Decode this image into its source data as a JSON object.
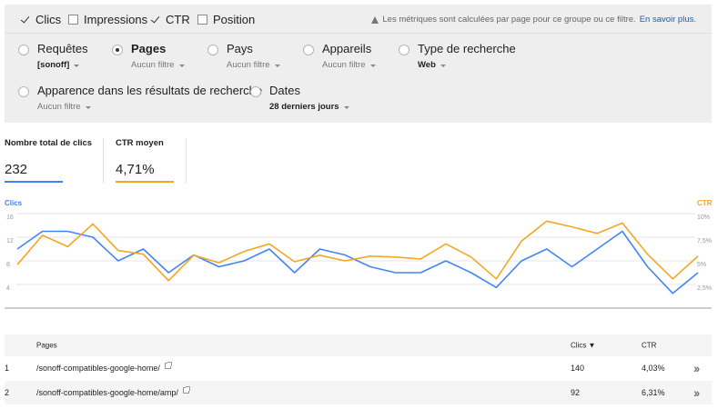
{
  "metrics": {
    "items": [
      {
        "label": "Clics",
        "checked": true
      },
      {
        "label": "Impressions",
        "checked": false
      },
      {
        "label": "CTR",
        "checked": true
      },
      {
        "label": "Position",
        "checked": false
      }
    ],
    "note": "Les métriques sont calculées par page pour ce groupe ou ce filtre.",
    "note_link": "En savoir plus."
  },
  "dimensions": [
    {
      "label": "Requêtes",
      "filter": "[sonoff]",
      "selected": false,
      "active_filter": true
    },
    {
      "label": "Pages",
      "filter": "Aucun filtre",
      "selected": true,
      "active_filter": false
    },
    {
      "label": "Pays",
      "filter": "Aucun filtre",
      "selected": false,
      "active_filter": false
    },
    {
      "label": "Appareils",
      "filter": "Aucun filtre",
      "selected": false,
      "active_filter": false
    },
    {
      "label": "Type de recherche",
      "filter": "Web",
      "selected": false,
      "active_filter": true
    },
    {
      "label": "Apparence dans les résultats de recherche",
      "filter": "Aucun filtre",
      "selected": false,
      "active_filter": false
    },
    {
      "label": "Dates",
      "filter": "28 derniers jours",
      "selected": false,
      "active_filter": true
    }
  ],
  "totals": [
    {
      "label": "Nombre total de clics",
      "value": "232",
      "color": "#4285f4"
    },
    {
      "label": "CTR moyen",
      "value": "4,71%",
      "color": "#f5a623"
    }
  ],
  "chart_data": {
    "type": "line",
    "left_axis_title": "Clics",
    "right_axis_title": "CTR",
    "left_ticks": [
      "16",
      "12",
      "8",
      "4"
    ],
    "right_ticks": [
      "10%",
      "7,5%",
      "5%",
      "2,5%"
    ],
    "ylim_left": [
      0,
      16
    ],
    "ylim_right": [
      0,
      10
    ],
    "grid": true,
    "series": [
      {
        "name": "Clics",
        "axis": "left",
        "color": "#4285f4",
        "values": [
          10,
          13,
          13,
          12,
          8,
          10,
          6,
          9,
          7,
          8,
          10,
          6,
          10,
          9,
          7,
          6,
          6,
          8,
          6,
          3.5,
          8,
          10,
          7,
          10,
          13,
          7,
          2.5,
          6
        ]
      },
      {
        "name": "CTR",
        "axis": "right",
        "color": "#f5a623",
        "values": [
          4.6,
          7.7,
          6.5,
          8.9,
          6.1,
          5.7,
          2.9,
          5.6,
          4.8,
          6.0,
          6.8,
          4.9,
          5.6,
          5.0,
          5.5,
          5.4,
          5.2,
          6.8,
          5.4,
          3.1,
          7.1,
          9.2,
          8.6,
          7.9,
          9.0,
          5.7,
          3.1,
          5.5
        ]
      }
    ]
  },
  "table": {
    "headers": {
      "rank": "",
      "page": "Pages",
      "clicks": "Clics ▼",
      "ctr": "CTR"
    },
    "rows": [
      {
        "rank": "1",
        "page": "/sonoff-compatibles-google-home/",
        "clicks": "140",
        "ctr": "4,03%"
      },
      {
        "rank": "2",
        "page": "/sonoff-compatibles-google-home/amp/",
        "clicks": "92",
        "ctr": "6,31%"
      }
    ]
  }
}
